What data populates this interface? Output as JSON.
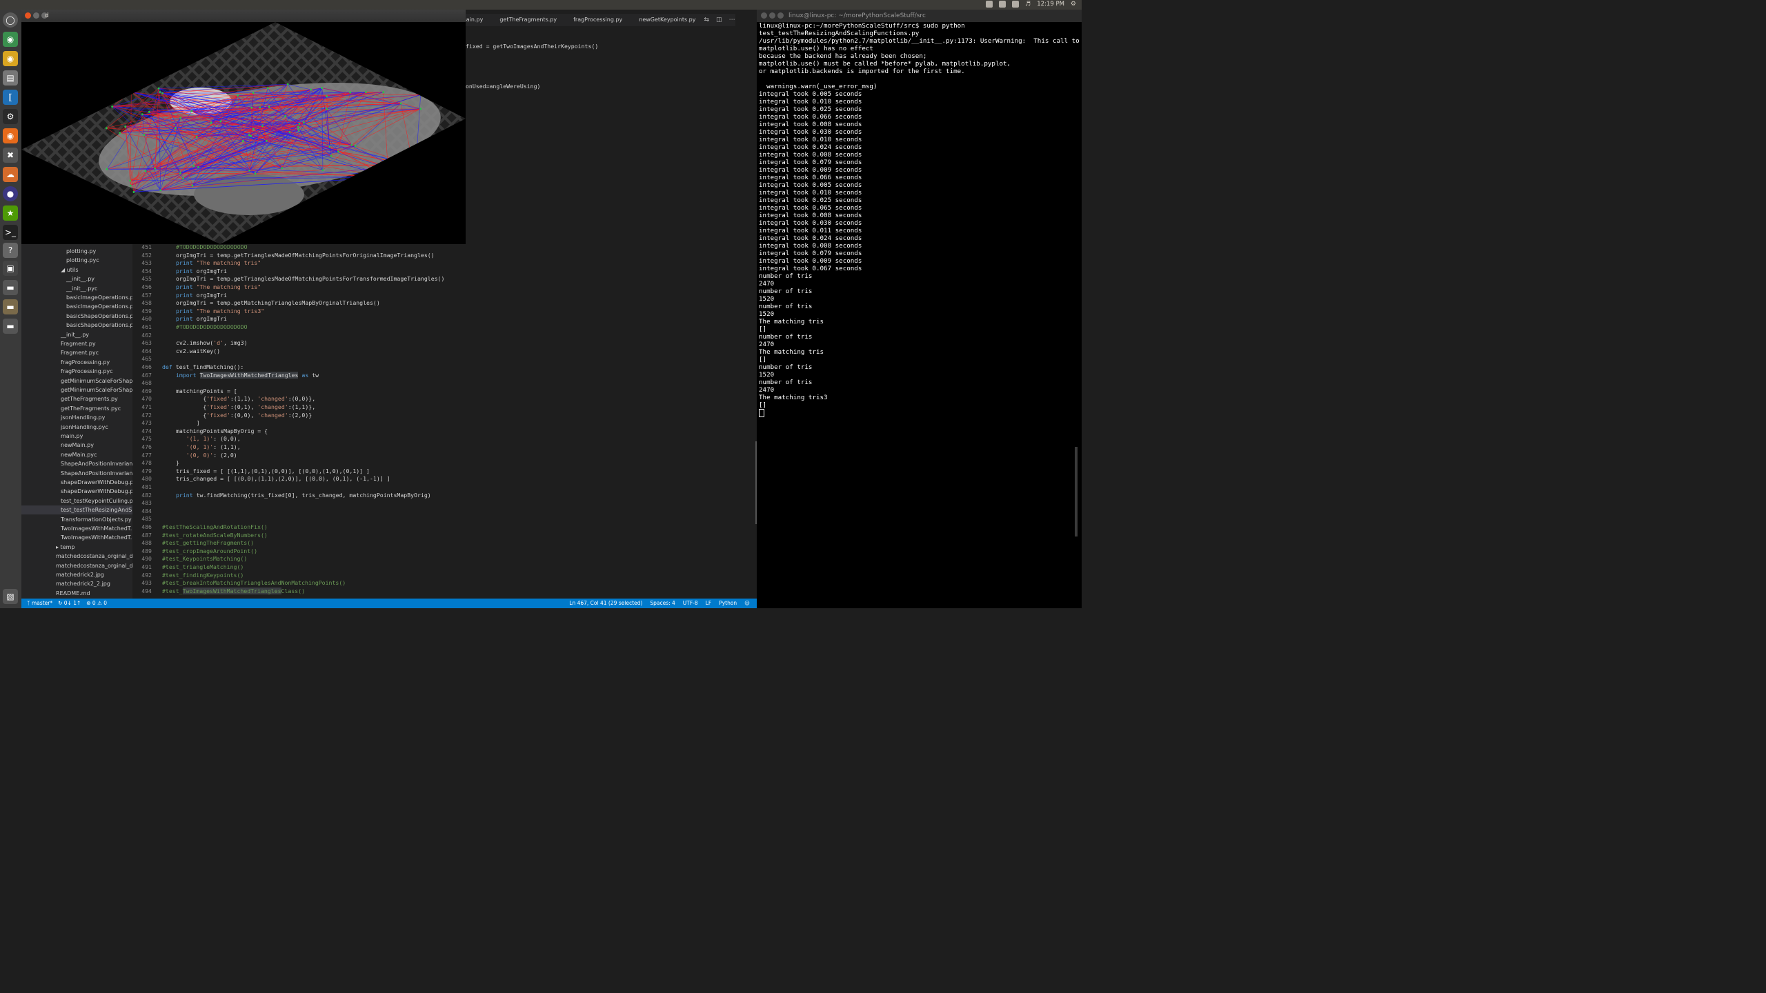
{
  "top_panel": {
    "time": "12:19 PM",
    "icons": [
      "dropbox-icon",
      "message-icon",
      "keyboard-icon",
      "volume-icon",
      "settings-icon"
    ]
  },
  "launcher": {
    "icons": [
      "ubuntu-dash-icon",
      "chrome-icon",
      "chrome-alt-icon",
      "files-icon",
      "vscode-icon",
      "steam-icon",
      "firefox-icon",
      "tools-icon",
      "ubuntu-one-icon",
      "eclipse-icon",
      "gimp-icon",
      "terminal-icon",
      "help-icon",
      "app-icon",
      "drive-icon",
      "drive-icon-2",
      "drive-icon-3",
      "trash-icon"
    ]
  },
  "image_window": {
    "title": "d"
  },
  "editor_tabs": [
    "main.py",
    "getTheFragments.py",
    "fragProcessing.py",
    "newGetKeypoints.py"
  ],
  "top_code": {
    "line1": "fixed = getTwoImagesAndTheirKeypoints()",
    "line2": "onUsed=angleWereUsing)"
  },
  "explorer": {
    "items": [
      {
        "label": "plotting.py",
        "indent": 3
      },
      {
        "label": "plotting.pyc",
        "indent": 3
      },
      {
        "label": "◢ utils",
        "indent": 2
      },
      {
        "label": "__init__.py",
        "indent": 3
      },
      {
        "label": "__init__.pyc",
        "indent": 3
      },
      {
        "label": "basicImageOperations.py",
        "indent": 3
      },
      {
        "label": "basicImageOperations.pyc",
        "indent": 3
      },
      {
        "label": "basicShapeOperations.py",
        "indent": 3
      },
      {
        "label": "basicShapeOperations.pyc",
        "indent": 3
      },
      {
        "label": "__init__.py",
        "indent": 2
      },
      {
        "label": "Fragment.py",
        "indent": 2
      },
      {
        "label": "Fragment.pyc",
        "indent": 2
      },
      {
        "label": "fragProcessing.py",
        "indent": 2
      },
      {
        "label": "fragProcessing.pyc",
        "indent": 2
      },
      {
        "label": "getMinimumScaleForShap...",
        "indent": 2
      },
      {
        "label": "getMinimumScaleForShap...",
        "indent": 2
      },
      {
        "label": "getTheFragments.py",
        "indent": 2
      },
      {
        "label": "getTheFragments.pyc",
        "indent": 2
      },
      {
        "label": "jsonHandling.py",
        "indent": 2
      },
      {
        "label": "jsonHandling.pyc",
        "indent": 2
      },
      {
        "label": "main.py",
        "indent": 2
      },
      {
        "label": "newMain.py",
        "indent": 2
      },
      {
        "label": "newMain.pyc",
        "indent": 2
      },
      {
        "label": "ShapeAndPositionInvarian...",
        "indent": 2
      },
      {
        "label": "ShapeAndPositionInvarian...",
        "indent": 2
      },
      {
        "label": "shapeDrawerWithDebug.py",
        "indent": 2
      },
      {
        "label": "shapeDrawerWithDebug.pyc",
        "indent": 2
      },
      {
        "label": "test_testKeypointCulling.py",
        "indent": 2
      },
      {
        "label": "test_testTheResizingAndS...",
        "indent": 2,
        "selected": true
      },
      {
        "label": "TransformationObjects.py",
        "indent": 2
      },
      {
        "label": "TwoImagesWithMatchedT...",
        "indent": 2
      },
      {
        "label": "TwoImagesWithMatchedT...",
        "indent": 2
      },
      {
        "label": "▸ temp",
        "indent": 1
      },
      {
        "label": "matchedcostanza_orginal_d...",
        "indent": 1
      },
      {
        "label": "matchedcostanza_orginal_d...",
        "indent": 1
      },
      {
        "label": "matchedrick2.jpg",
        "indent": 1
      },
      {
        "label": "matchedrick2_2.jpg",
        "indent": 1
      },
      {
        "label": "README.md",
        "indent": 1
      }
    ]
  },
  "code_lines": [
    {
      "n": "451",
      "html": "<span class='cm'>#TODODODODODODODODODO</span>"
    },
    {
      "n": "452",
      "html": "orgImgTri = temp.getTrianglesMadeOfMatchingPointsForOriginalImageTriangles()"
    },
    {
      "n": "453",
      "html": "<span class='kw'>print</span> <span class='str'>\"The matching tris\"</span>"
    },
    {
      "n": "454",
      "html": "<span class='kw'>print</span> orgImgTri"
    },
    {
      "n": "455",
      "html": "orgImgTri = temp.getTrianglesMadeOfMatchingPointsForTransformedImageTriangles()"
    },
    {
      "n": "456",
      "html": "<span class='kw'>print</span> <span class='str'>\"The matching tris\"</span>"
    },
    {
      "n": "457",
      "html": "<span class='kw'>print</span> orgImgTri"
    },
    {
      "n": "458",
      "html": "orgImgTri = temp.getMatchingTrianglesMapByOrginalTriangles()"
    },
    {
      "n": "459",
      "html": "<span class='kw'>print</span> <span class='str'>\"The matching tris3\"</span>"
    },
    {
      "n": "460",
      "html": "<span class='kw'>print</span> orgImgTri"
    },
    {
      "n": "461",
      "html": "<span class='cm'>#TODODODODODODODODODO</span>"
    },
    {
      "n": "462",
      "html": ""
    },
    {
      "n": "463",
      "html": "cv2.imshow(<span class='str'>'d'</span>, img3)"
    },
    {
      "n": "464",
      "html": "cv2.waitKey()"
    },
    {
      "n": "465",
      "html": ""
    },
    {
      "n": "466",
      "html": "<span class='kw'>def</span> test_findMatching():",
      "outdent": true
    },
    {
      "n": "467",
      "html": "<span class='kw'>import</span> <span class='hl'>TwoImagesWithMatchedTriangles</span> <span class='kw'>as</span> tw"
    },
    {
      "n": "468",
      "html": ""
    },
    {
      "n": "469",
      "html": "matchingPoints = ["
    },
    {
      "n": "470",
      "html": "        {<span class='str'>'fixed'</span>:(1,1), <span class='str'>'changed'</span>:(0,0)},"
    },
    {
      "n": "471",
      "html": "        {<span class='str'>'fixed'</span>:(0,1), <span class='str'>'changed'</span>:(1,1)},"
    },
    {
      "n": "472",
      "html": "        {<span class='str'>'fixed'</span>:(0,0), <span class='str'>'changed'</span>:(2,0)}"
    },
    {
      "n": "473",
      "html": "      ]"
    },
    {
      "n": "474",
      "html": "matchingPointsMapByOrig = {"
    },
    {
      "n": "475",
      "html": "   <span class='str'>'(1, 1)'</span>: (0,0),"
    },
    {
      "n": "476",
      "html": "   <span class='str'>'(0, 1)'</span>: (1,1),"
    },
    {
      "n": "477",
      "html": "   <span class='str'>'(0, 0)'</span>: (2,0)"
    },
    {
      "n": "478",
      "html": "}"
    },
    {
      "n": "479",
      "html": "tris_fixed = [ [(1,1),(0,1),(0,0)], [(0,0),(1,0),(0,1)] ]"
    },
    {
      "n": "480",
      "html": "tris_changed = [ [(0,0),(1,1),(2,0)], [(0,0), (0,1), (-1,-1)] ]"
    },
    {
      "n": "481",
      "html": ""
    },
    {
      "n": "482",
      "html": "<span class='kw'>print</span> tw.findMatching(tris_fixed[0], tris_changed, matchingPointsMapByOrig)"
    },
    {
      "n": "483",
      "html": ""
    },
    {
      "n": "484",
      "html": ""
    },
    {
      "n": "485",
      "html": ""
    },
    {
      "n": "486",
      "html": "<span class='cm'>#testTheScalingAndRotationFix()</span>",
      "outdent": true
    },
    {
      "n": "487",
      "html": "<span class='cm'>#test_rotateAndScaleByNumbers()</span>",
      "outdent": true
    },
    {
      "n": "488",
      "html": "<span class='cm'>#test_gettingTheFragments()</span>",
      "outdent": true
    },
    {
      "n": "489",
      "html": "<span class='cm'>#test_cropImageAroundPoint()</span>",
      "outdent": true
    },
    {
      "n": "490",
      "html": "<span class='cm'>#test_KeypointsMatching()</span>",
      "outdent": true
    },
    {
      "n": "491",
      "html": "<span class='cm'>#test_triangleMatching()</span>",
      "outdent": true
    },
    {
      "n": "492",
      "html": "<span class='cm'>#test_findingKeypoints()</span>",
      "outdent": true
    },
    {
      "n": "493",
      "html": "<span class='cm'>#test_breakIntoMatchingTrianglesAndNonMatchingPoints()</span>",
      "outdent": true
    },
    {
      "n": "494",
      "html": "<span class='cm'>#test_<span class='hl'>TwoImagesWithMatchedTriangles</span>Class()</span>",
      "outdent": true
    }
  ],
  "status_bar": {
    "branch": "master*",
    "sync": "↻ 0↓ 1↑",
    "problems": "⊗ 0 ⚠ 0",
    "position": "Ln 467, Col 41 (29 selected)",
    "spaces": "Spaces: 4",
    "encoding": "UTF-8",
    "eol": "LF",
    "language": "Python",
    "feedback_icon": "smiley-icon"
  },
  "terminal": {
    "title": "linux@linux-pc: ~/morePythonScaleStuff/src",
    "lines": [
      "linux@linux-pc:~/morePythonScaleStuff/src$ sudo python test_testTheResizingAndScalingFunctions.py",
      "/usr/lib/pymodules/python2.7/matplotlib/__init__.py:1173: UserWarning:  This call to matplotlib.use() has no effect",
      "because the backend has already been chosen;",
      "matplotlib.use() must be called *before* pylab, matplotlib.pyplot,",
      "or matplotlib.backends is imported for the first time.",
      "",
      "  warnings.warn(_use_error_msg)",
      "integral took 0.005 seconds",
      "integral took 0.010 seconds",
      "integral took 0.025 seconds",
      "integral took 0.066 seconds",
      "integral took 0.008 seconds",
      "integral took 0.030 seconds",
      "integral took 0.010 seconds",
      "integral took 0.024 seconds",
      "integral took 0.008 seconds",
      "integral took 0.079 seconds",
      "integral took 0.009 seconds",
      "integral took 0.066 seconds",
      "integral took 0.005 seconds",
      "integral took 0.010 seconds",
      "integral took 0.025 seconds",
      "integral took 0.065 seconds",
      "integral took 0.008 seconds",
      "integral took 0.030 seconds",
      "integral took 0.011 seconds",
      "integral took 0.024 seconds",
      "integral took 0.008 seconds",
      "integral took 0.079 seconds",
      "integral took 0.009 seconds",
      "integral took 0.067 seconds",
      "number of tris",
      "2470",
      "number of tris",
      "1520",
      "number of tris",
      "1520",
      "The matching tris",
      "[]",
      "number of tris",
      "2470",
      "The matching tris",
      "[]",
      "number of tris",
      "1520",
      "number of tris",
      "2470",
      "The matching tris3",
      "[]"
    ]
  }
}
